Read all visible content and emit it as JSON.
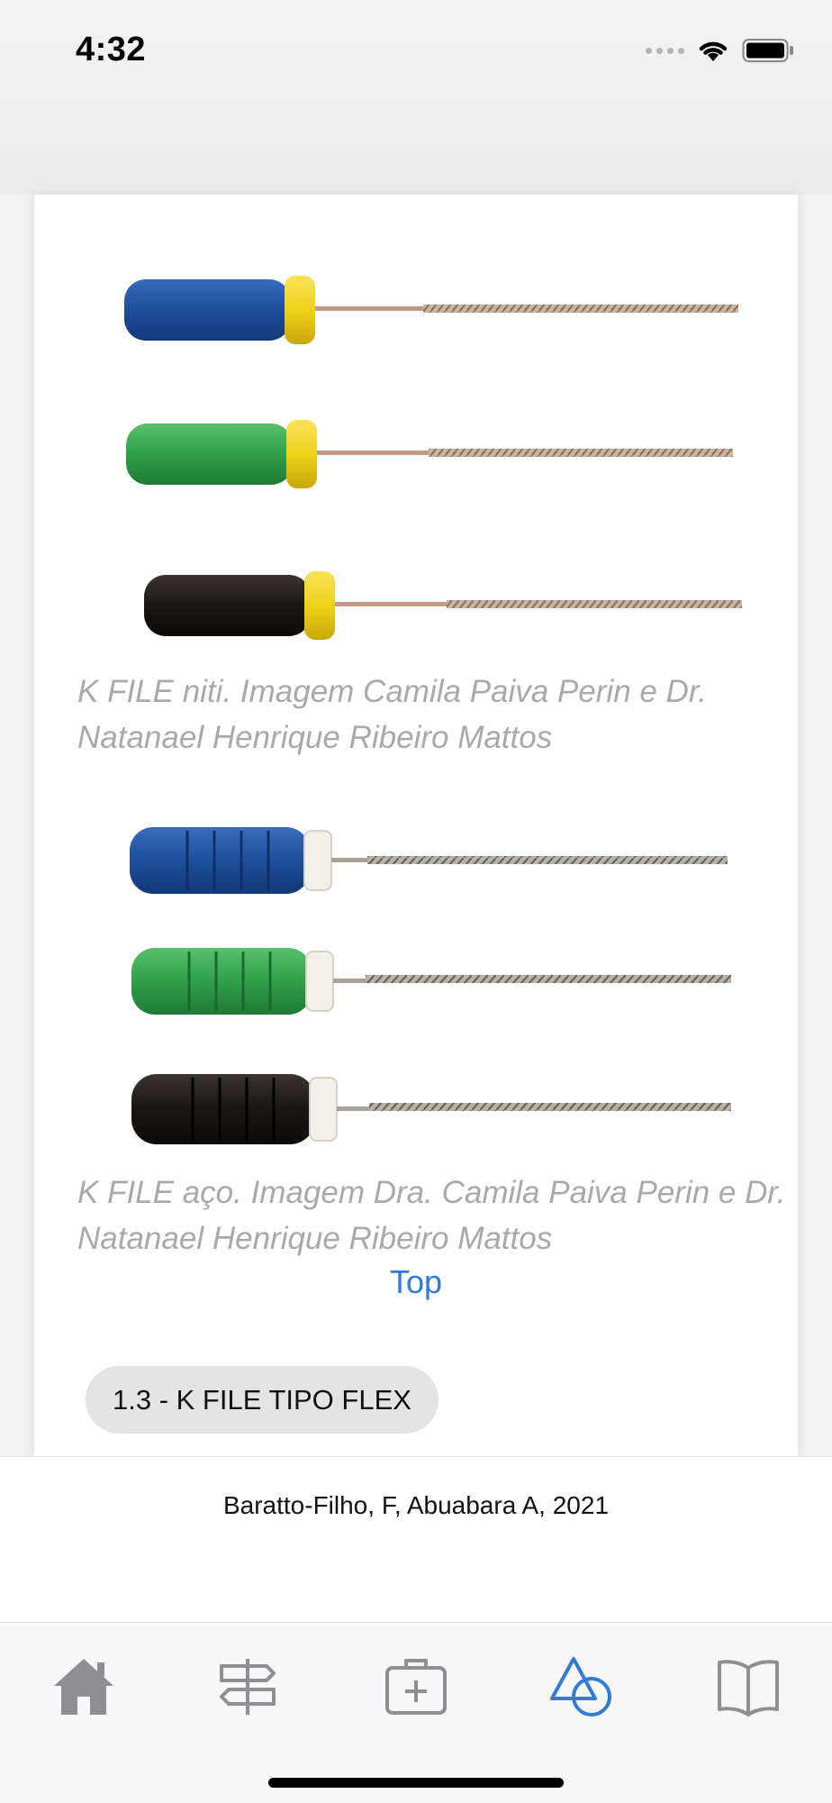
{
  "status_bar": {
    "time": "4:32"
  },
  "content": {
    "captions": [
      "K FILE niti. Imagem Camila Paiva Perin e Dr. Natanael Henrique Ribeiro Mattos",
      "K FILE aço. Imagem Dra. Camila Paiva Perin e Dr. Natanael Henrique Ribeiro Mattos"
    ],
    "top_link": "Top",
    "section_button": "1.3 - K FILE TIPO FLEX"
  },
  "footer": {
    "credit": "Baratto-Filho, F, Abuabara A, 2021"
  },
  "tab_bar": {
    "active_color": "#2f7bd8",
    "inactive_color": "#8e8e93",
    "tabs": [
      {
        "icon": "home-icon",
        "active": false
      },
      {
        "icon": "signpost-icon",
        "active": false
      },
      {
        "icon": "medical-kit-icon",
        "active": false
      },
      {
        "icon": "shapes-icon",
        "active": true
      },
      {
        "icon": "book-icon",
        "active": false
      }
    ]
  },
  "colors": {
    "handle_blue": "#1d4f9c",
    "handle_green": "#2fa04a",
    "handle_black": "#1a1614",
    "stopper_yellow": "#f1d11a",
    "stopper_white": "#f2f0e8",
    "caption_gray": "#a9a9a9",
    "link_blue": "#2f7bd8"
  }
}
